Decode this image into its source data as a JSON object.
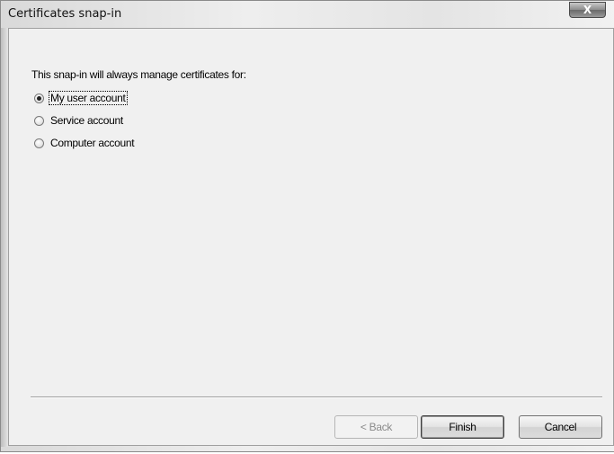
{
  "window": {
    "title": "Certificates snap-in",
    "close_label": "X"
  },
  "dialog": {
    "instruction": "This snap-in will always manage certificates for:",
    "options": [
      {
        "label": "My user account",
        "checked": true
      },
      {
        "label": "Service account",
        "checked": false
      },
      {
        "label": "Computer account",
        "checked": false
      }
    ]
  },
  "buttons": {
    "back": "< Back",
    "finish": "Finish",
    "cancel": "Cancel"
  }
}
